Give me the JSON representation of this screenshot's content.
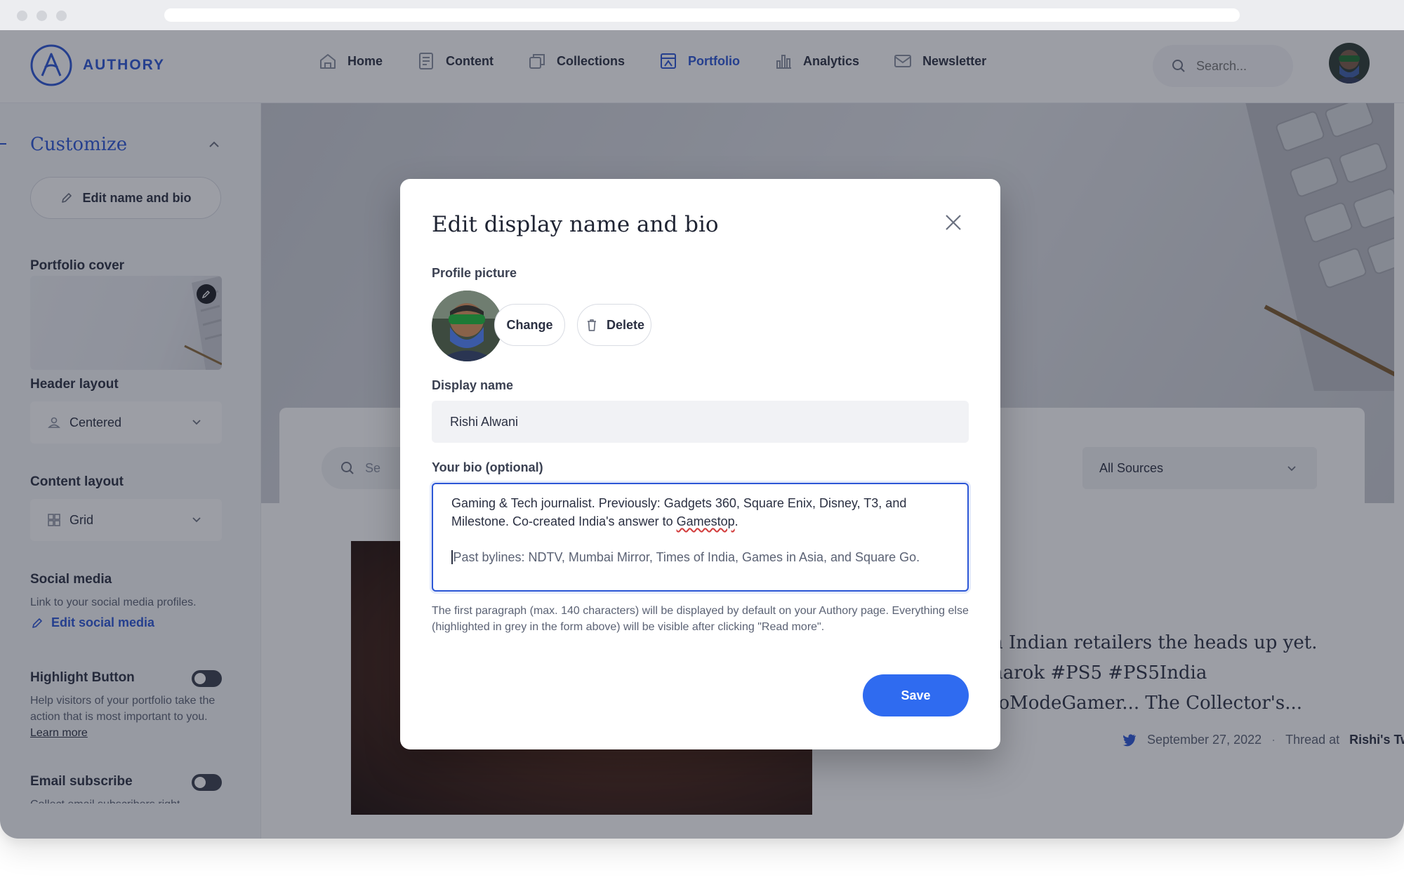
{
  "app": {
    "logo_text": "AUTHORY",
    "brand_color": "#2c57d6"
  },
  "nav": {
    "items": [
      {
        "label": "Home",
        "icon": "home-icon",
        "active": false
      },
      {
        "label": "Content",
        "icon": "document-icon",
        "active": false
      },
      {
        "label": "Collections",
        "icon": "collections-icon",
        "active": false
      },
      {
        "label": "Portfolio",
        "icon": "portfolio-icon",
        "active": true
      },
      {
        "label": "Analytics",
        "icon": "bar-chart-icon",
        "active": false
      },
      {
        "label": "Newsletter",
        "icon": "mail-icon",
        "active": false
      }
    ],
    "search_placeholder": "Search..."
  },
  "sidebar": {
    "title": "Customize",
    "edit_name_bio": "Edit name and bio",
    "portfolio_cover": "Portfolio cover",
    "header_layout": {
      "label": "Header layout",
      "value": "Centered"
    },
    "content_layout": {
      "label": "Content layout",
      "value": "Grid"
    },
    "social_media": {
      "label": "Social media",
      "description": "Link to your social media profiles.",
      "link": "Edit social media"
    },
    "highlight_button": {
      "label": "Highlight Button",
      "description": "Help visitors of your portfolio take the action that is most important to you.",
      "learn_more": "Learn more",
      "enabled": false
    },
    "email_subscribe": {
      "label": "Email subscribe",
      "description": "Collect email subscribers right",
      "enabled": false
    }
  },
  "preview": {
    "search_placeholder": "Se",
    "source_filter": "All Sources",
    "card": {
      "text_lines": [
        "n Indian retailers the heads up yet.",
        "narok #PS5 #PS5India",
        "toModeGamer... The Collector's..."
      ],
      "date": "September 27, 2022",
      "separator": "·",
      "thread_prefix": "Thread at",
      "source": "Rishi's Twitter"
    }
  },
  "modal": {
    "title": "Edit display name and bio",
    "profile_picture_label": "Profile picture",
    "change_button": "Change",
    "delete_button": "Delete",
    "display_name_label": "Display name",
    "display_name_value": "Rishi Alwani",
    "bio_label": "Your bio (optional)",
    "bio_paragraph_1_before": "Gaming & Tech journalist. Previously: Gadgets 360, Square Enix, Disney, T3, and Milestone. Co-created India's answer to ",
    "bio_paragraph_1_link": "Gamestop",
    "bio_paragraph_1_after": ".",
    "bio_paragraph_2": "Past bylines: NDTV, Mumbai Mirror, Times of India, Games in Asia, and Square Go.",
    "hint": "The first paragraph (max. 140 characters) will be displayed by default on your Authory page. Everything else (highlighted in grey in the form above) will be visible after clicking \"Read more\".",
    "save_button": "Save"
  }
}
